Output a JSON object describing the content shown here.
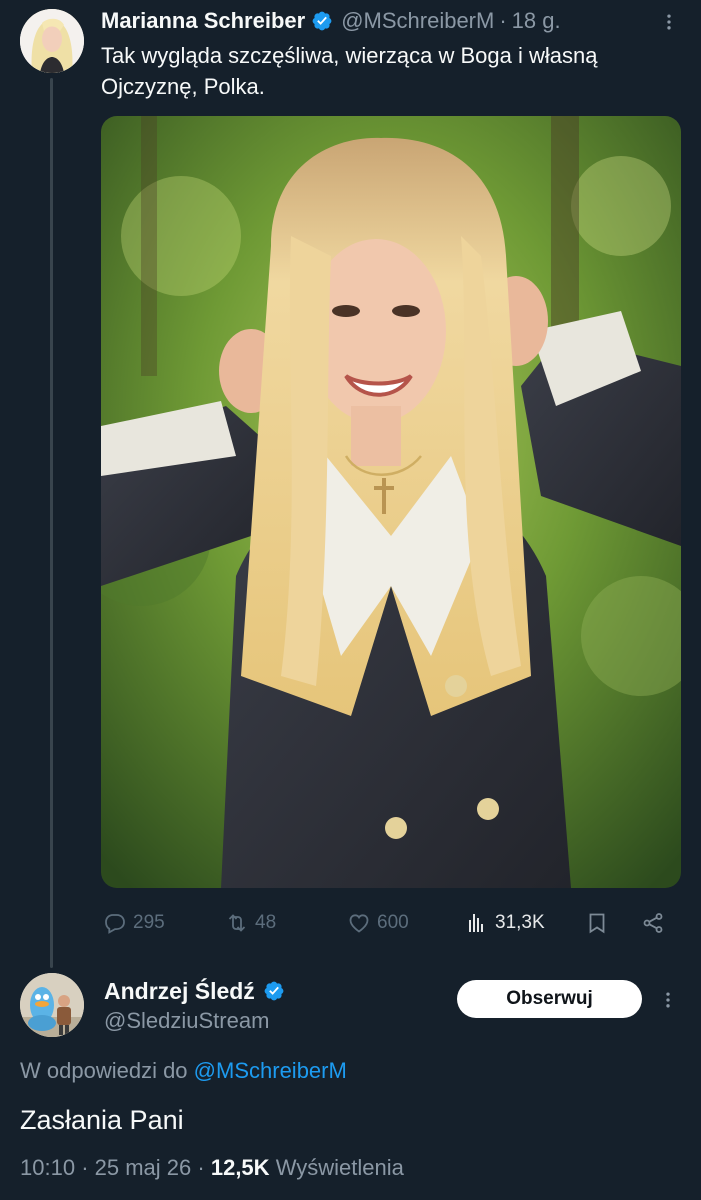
{
  "tweet1": {
    "author_name": "Marianna Schreiber",
    "handle": "@MSchreiberM",
    "separator": "·",
    "time": "18 g.",
    "text": "Tak wygląda szczęśliwa, wierząca w Boga i własną Ojczyznę, Polka.",
    "stats": {
      "replies": "295",
      "reposts": "48",
      "likes": "600",
      "views": "31,3K"
    }
  },
  "tweet2": {
    "author_name": "Andrzej Śledź",
    "handle": "@SledziuStream",
    "follow_label": "Obserwuj",
    "reply_prefix": "W odpowiedzi do",
    "reply_mention": "@MSchreiberM",
    "text": "Zasłania Pani",
    "time": "10:10",
    "date": "25 maj 26",
    "separator": "·",
    "views_count": "12,5K",
    "views_label": "Wyświetlenia"
  },
  "colors": {
    "background": "#15202b",
    "text_primary": "#f7f9f9",
    "text_secondary": "#8b98a5",
    "accent": "#1d9bf0",
    "thread_line": "#38444d"
  },
  "icons": [
    "verified-badge-icon",
    "more-dots-icon",
    "reply-icon",
    "repost-icon",
    "like-icon",
    "views-icon",
    "bookmark-icon",
    "share-icon"
  ]
}
